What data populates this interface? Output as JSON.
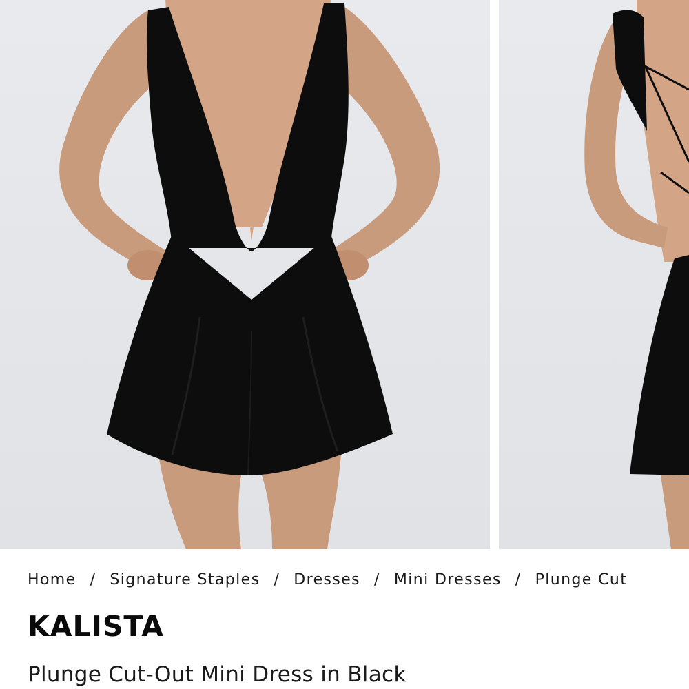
{
  "gallery": {
    "images": [
      {
        "label": "product-photo-front"
      },
      {
        "label": "product-photo-back"
      }
    ]
  },
  "breadcrumb": {
    "items": [
      "Home",
      "Signature Staples",
      "Dresses",
      "Mini Dresses",
      "Plunge Cut"
    ],
    "separator": "/"
  },
  "product": {
    "brand": "KALISTA",
    "name": "Plunge Cut-Out Mini Dress in Black"
  },
  "colors": {
    "background": "#ffffff",
    "photo_background": "#e4e6ea",
    "dress": "#0d0d0d",
    "text": "#111111"
  }
}
